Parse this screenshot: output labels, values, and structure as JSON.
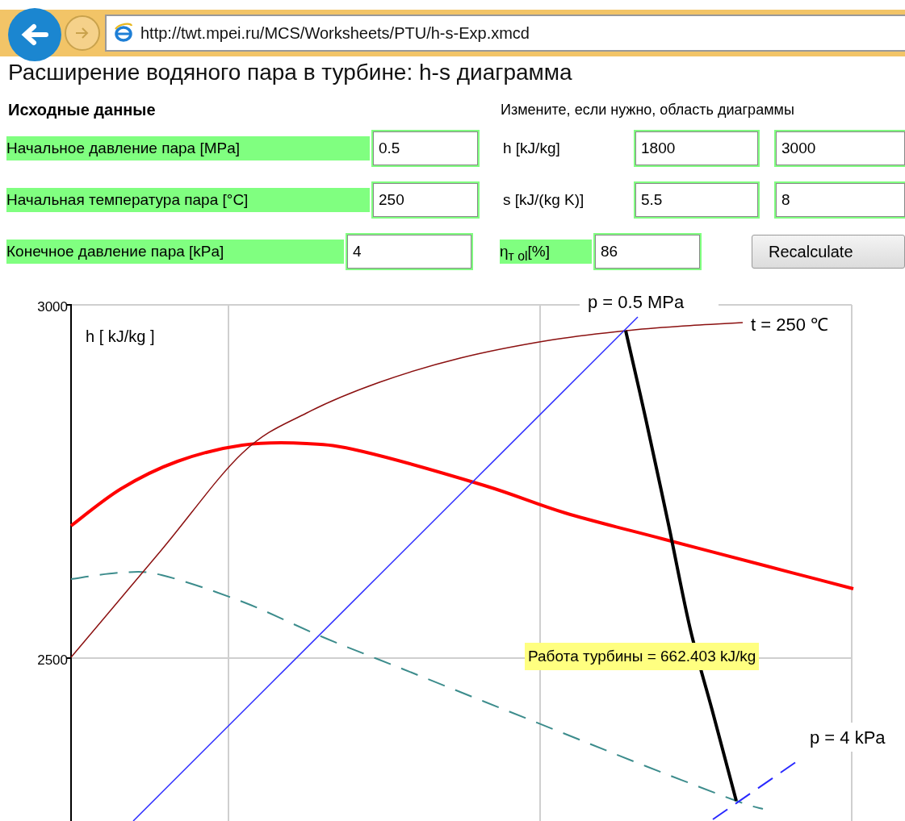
{
  "browser": {
    "address": "http://twt.mpei.ru/MCS/Worksheets/PTU/h-s-Exp.xmcd"
  },
  "title": "Расширение водяного пара в турбине: h-s диаграмма",
  "inputs_section": {
    "heading": "Исходные данные",
    "fields": [
      {
        "label": "Начальное давление пара [MPa]",
        "value": "0.5"
      },
      {
        "label": "Начальная температура пара [°C]",
        "value": "250"
      },
      {
        "label": "Конечное давление пара [kPa]",
        "value": "4"
      }
    ]
  },
  "range_section": {
    "hint": "Измените, если нужно, область диаграммы",
    "fields": [
      {
        "label": "h [kJ/kg]",
        "values": [
          "1800",
          "3000"
        ]
      },
      {
        "label": "s [kJ/(kg K)]",
        "values": [
          "5.5",
          "8"
        ]
      }
    ]
  },
  "efficiency": {
    "label": "η$_{т ol}$[%]",
    "value": "86"
  },
  "button": "Recalculate",
  "chart": {
    "y_ticks": [
      "3000",
      "2500"
    ],
    "y_label": "h [ kJ/kg ]",
    "curve_labels": [
      "p = 0.5 MPa",
      "t = 250 ℃",
      "p = 4 kPa"
    ],
    "result": "Работа турбины = 662.403 kJ/kg"
  }
}
